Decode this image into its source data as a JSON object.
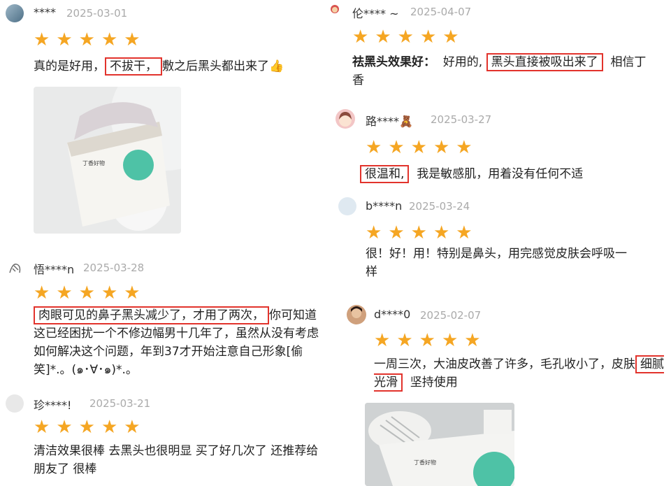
{
  "reviews": [
    {
      "user": "****",
      "date": "2025-03-01",
      "text_before": "真的是好用，",
      "highlight": "不拔干，",
      "text_after": "敷之后黑头都出来了👍",
      "photo_label": "丁香好物"
    },
    {
      "user": "悟****n",
      "date": "2025-03-28",
      "highlight": "肉眼可见的鼻子黑头减少了，才用了两次，",
      "text_after": "你可知道这已经困扰一个不修边幅男十几年了，虽然从没有考虑如何解决这个问题，年到37才开始注意自己形象[偷笑]*.。(๑･∀･๑)*.。"
    },
    {
      "user": "珍****!",
      "date": "2025-03-21",
      "text": "清洁效果很棒 去黑头也很明显 买了好几次了 还推荐给朋友了 很棒"
    },
    {
      "user": "伦**** ~",
      "date": "2025-04-07",
      "prefix": "祛黑头效果好：",
      "text_before": "好用的,",
      "highlight": "黑头直接被吸出来了",
      "text_after": "相信丁香"
    },
    {
      "user": "路****🧸",
      "date": "2025-03-27",
      "highlight": "很温和,",
      "text_after": "我是敏感肌，用着没有任何不适"
    },
    {
      "user": "b****n",
      "date": "2025-03-24",
      "text": "很！好！用！特别是鼻头，用完感觉皮肤会呼吸一样"
    },
    {
      "user": "d****0",
      "date": "2025-02-07",
      "text_before": "一周三次，大油皮改善了许多，毛孔收小了，皮肤",
      "highlight": "细腻光滑",
      "text_after": "坚持使用",
      "photo_label": "丁香好物"
    }
  ],
  "stars": "★",
  "colors": {
    "star": "#f5a623",
    "highlight_border": "#e2332c",
    "date": "#aaaaaa"
  }
}
